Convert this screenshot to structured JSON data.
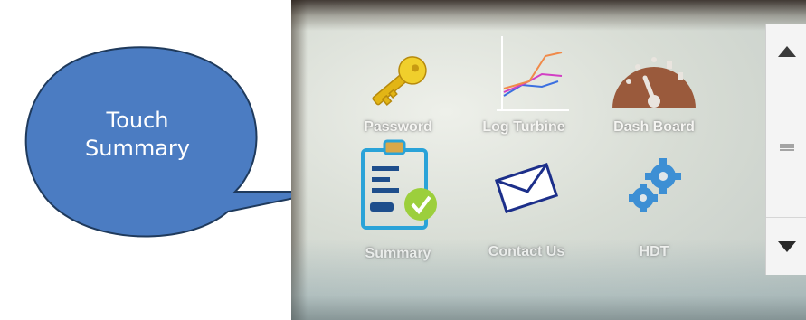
{
  "callout": {
    "text_line1": "Touch",
    "text_line2": "Summary",
    "fill": "#4b7cc2",
    "stroke": "#1f3a5c"
  },
  "screen": {
    "tiles": [
      {
        "label": "Password",
        "icon": "key-icon"
      },
      {
        "label": "Log Turbine",
        "icon": "line-chart-icon"
      },
      {
        "label": "Dash Board",
        "icon": "gauge-icon"
      },
      {
        "label": "Summary",
        "icon": "clipboard-check-icon"
      },
      {
        "label": "Contact Us",
        "icon": "envelope-icon"
      },
      {
        "label": "HDT",
        "icon": "gears-icon"
      }
    ],
    "scrollbar": {
      "up": "scroll-up-arrow",
      "thumb": "scroll-thumb",
      "down": "scroll-down-arrow"
    }
  },
  "colors": {
    "icon_blue": "#2aa3d8",
    "check_green": "#9ccf3c",
    "gauge_brown": "#9a5a3c",
    "key_yellow": "#e8c21c"
  }
}
